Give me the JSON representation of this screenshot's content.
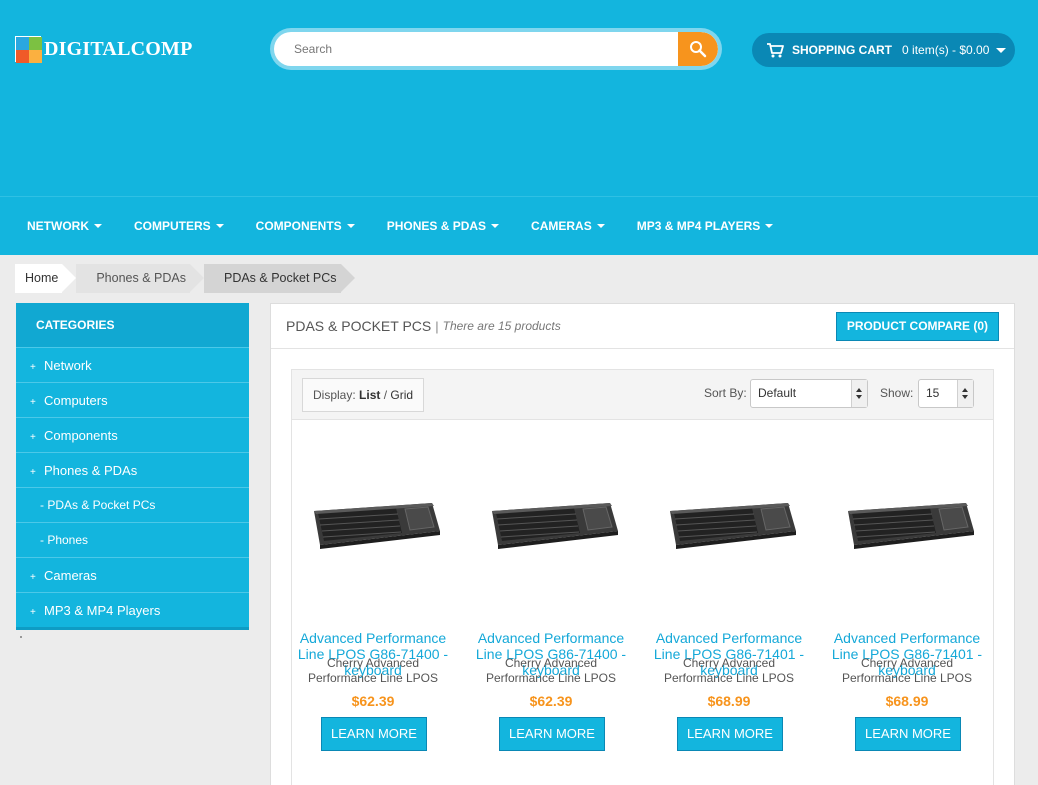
{
  "logo": {
    "text": "DIGITALCOMP"
  },
  "search": {
    "placeholder": "Search"
  },
  "cart": {
    "title": "SHOPPING CART",
    "summary": "0 item(s) - $0.00"
  },
  "nav": {
    "items": [
      "NETWORK",
      "COMPUTERS",
      "COMPONENTS",
      "PHONES & PDAS",
      "CAMERAS",
      "MP3 & MP4 PLAYERS"
    ]
  },
  "breadcrumb": {
    "items": [
      "Home",
      "Phones & PDAs",
      "PDAs & Pocket PCs"
    ]
  },
  "categories": {
    "title": "CATEGORIES",
    "items": [
      "Network",
      "Computers",
      "Components",
      "Phones & PDAs",
      "- PDAs & Pocket PCs",
      "- Phones",
      "Cameras",
      "MP3 & MP4 Players"
    ]
  },
  "main": {
    "title": "PDAS & POCKET PCS",
    "separator": "|",
    "count_text": "There are 15 products",
    "compare_label": "PRODUCT COMPARE (0)"
  },
  "toolbar": {
    "display_label": "Display:",
    "list_label": "List",
    "slash": "/",
    "grid_label": "Grid",
    "sort_label": "Sort By:",
    "sort_value": "Default",
    "show_label": "Show:",
    "show_value": "15"
  },
  "products": [
    {
      "name": "Advanced Performance Line LPOS G86-71400 - keyboard",
      "desc": "Cherry Advanced Performance Line LPOS",
      "price": "$62.39",
      "button": "LEARN MORE"
    },
    {
      "name": "Advanced Performance Line LPOS G86-71400 - keyboard",
      "desc": "Cherry Advanced Performance Line LPOS",
      "price": "$62.39",
      "button": "LEARN MORE"
    },
    {
      "name": "Advanced Performance Line LPOS G86-71401 - keyboard",
      "desc": "Cherry Advanced Performance Line LPOS",
      "price": "$68.99",
      "button": "LEARN MORE"
    },
    {
      "name": "Advanced Performance Line LPOS G86-71401 - keyboard",
      "desc": "Cherry Advanced Performance Line LPOS",
      "price": "$68.99",
      "button": "LEARN MORE"
    }
  ],
  "colors": {
    "brand": "#13b5de",
    "price": "#f7941d",
    "search_button": "#f7941d",
    "cart_bg": "#0a88b5"
  }
}
